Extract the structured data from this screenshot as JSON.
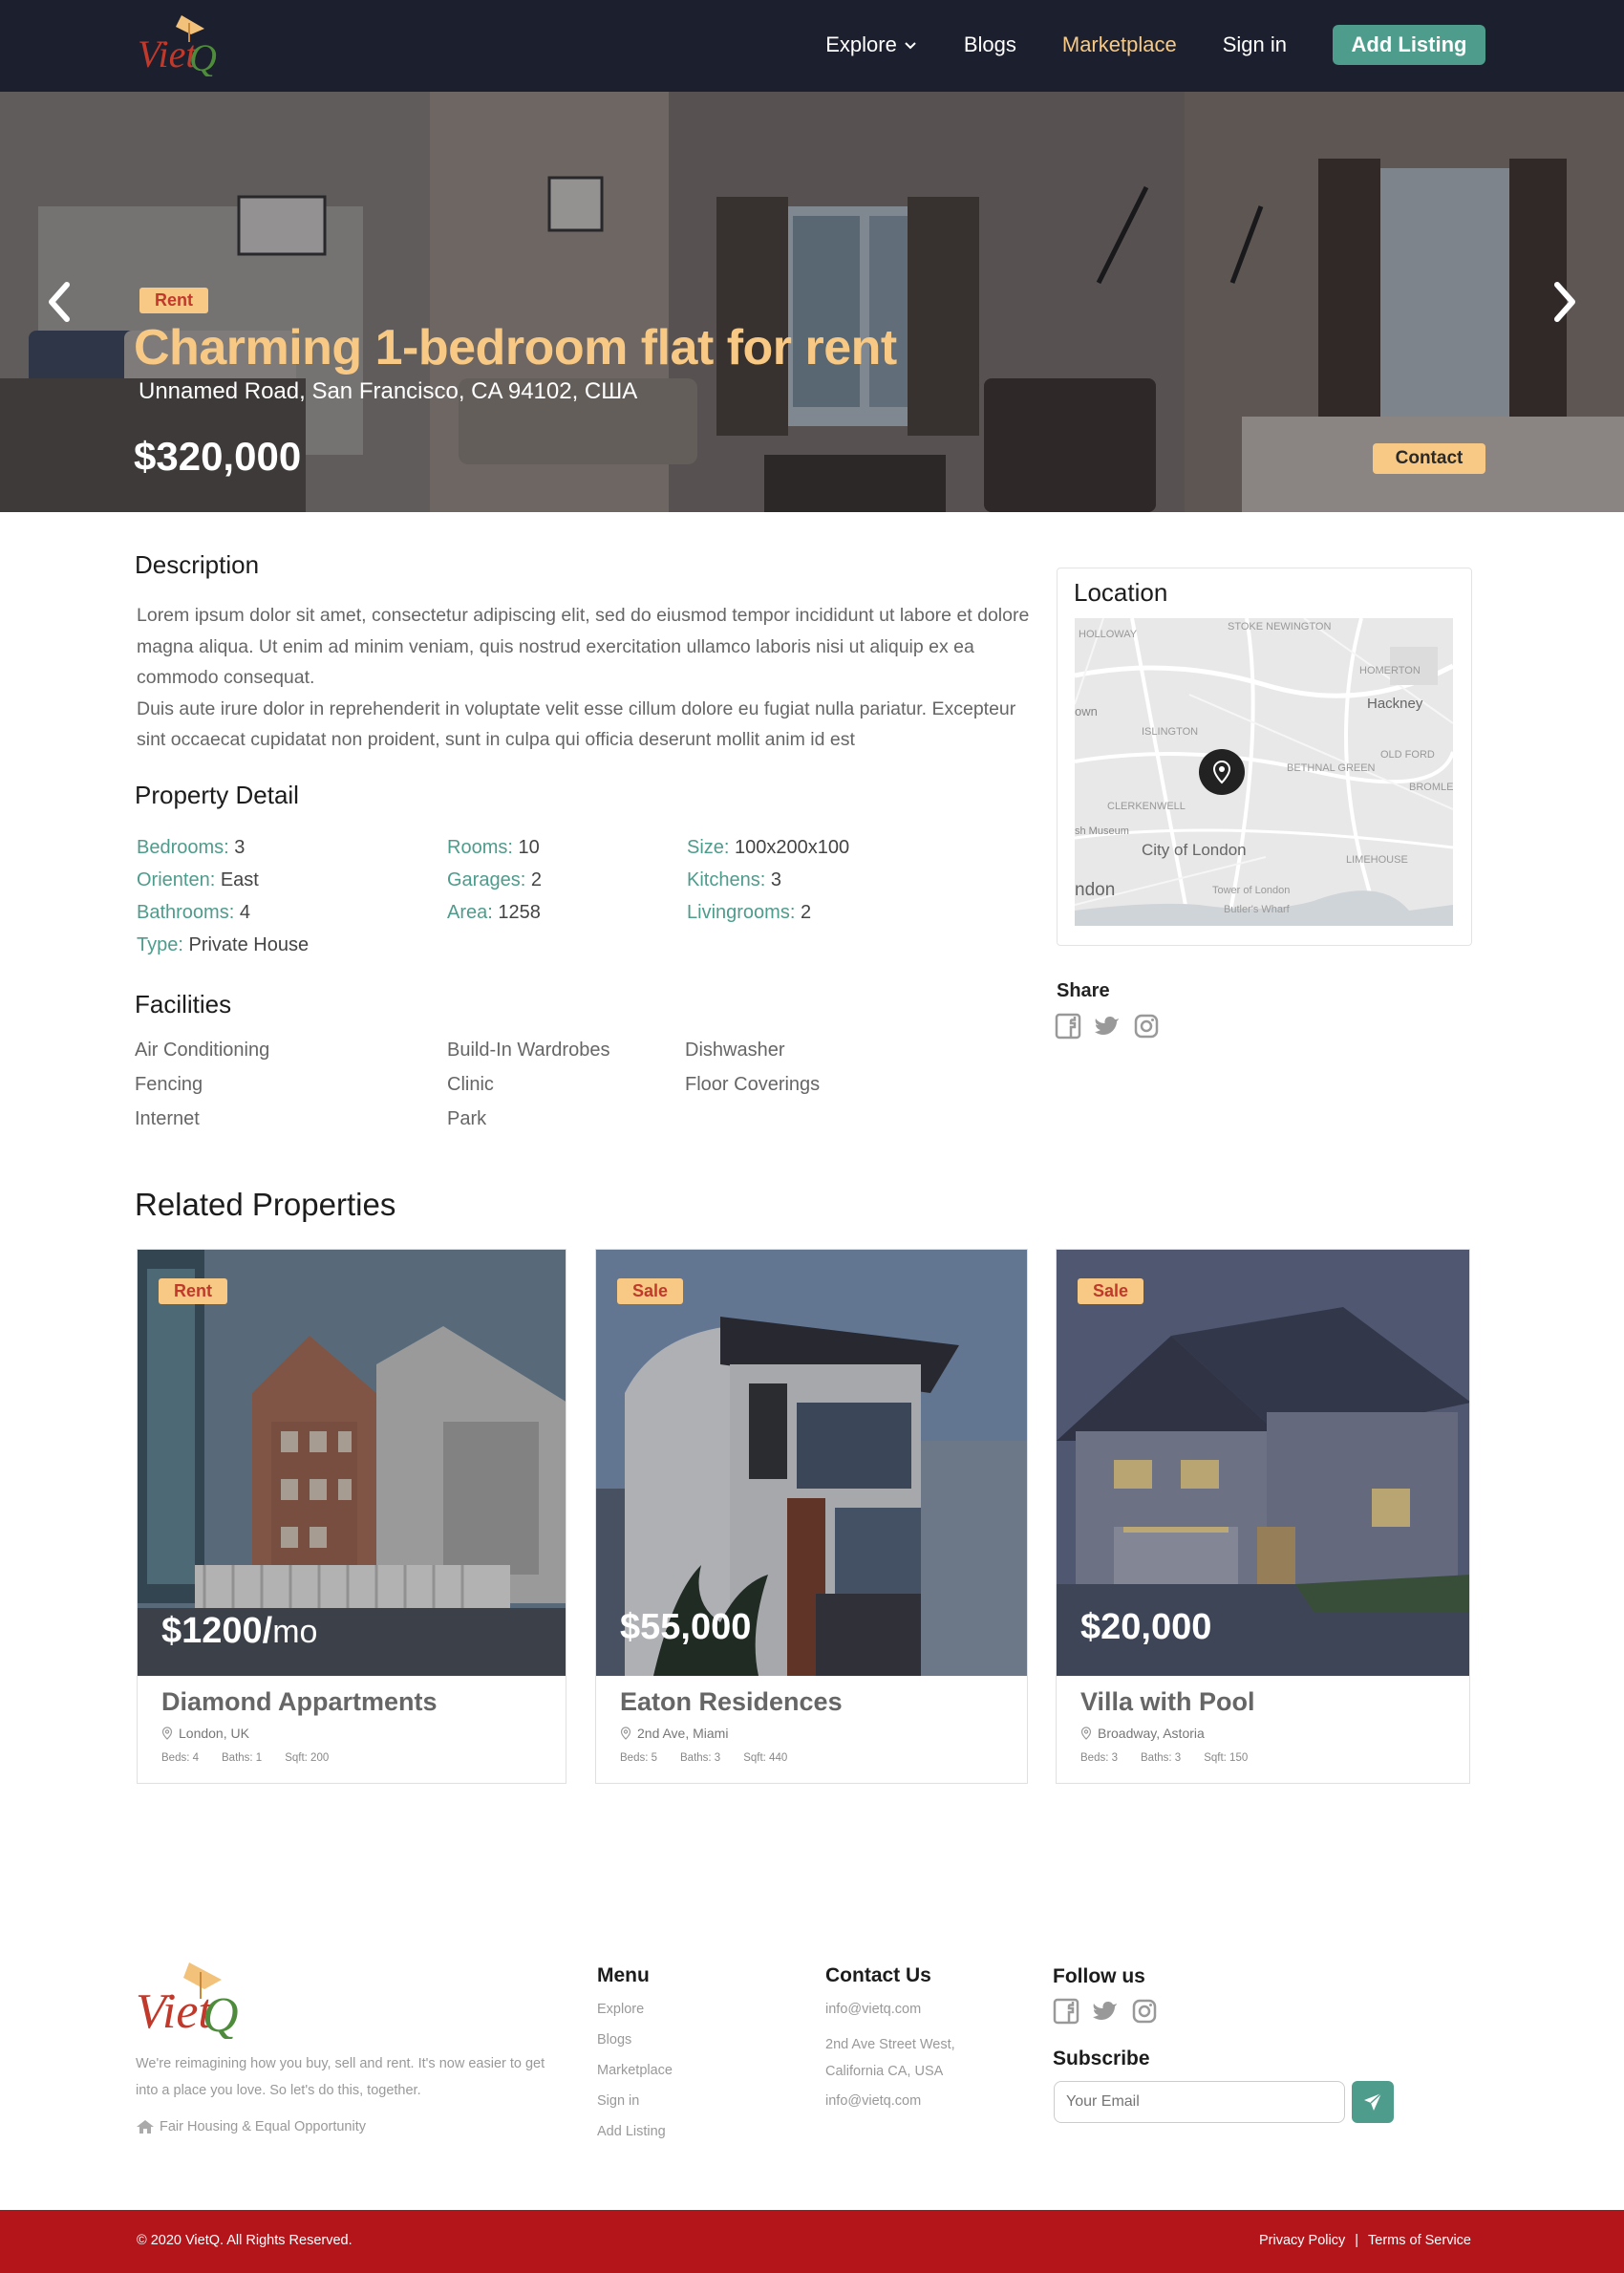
{
  "nav": {
    "logo_text": "VietQ",
    "links": [
      {
        "label": "Explore",
        "has_dropdown": true
      },
      {
        "label": "Blogs"
      },
      {
        "label": "Marketplace",
        "active": true
      },
      {
        "label": "Sign in"
      }
    ],
    "add_listing": "Add Listing"
  },
  "hero": {
    "badge": "Rent",
    "title": "Charming 1-bedroom flat for rent",
    "address": "Unnamed Road, San Francisco, CA 94102, США",
    "price": "$320,000",
    "contact": "Contact"
  },
  "description": {
    "heading": "Description",
    "text": "Lorem ipsum dolor sit amet, consectetur adipiscing elit, sed do eiusmod tempor incididunt ut labore et dolore magna aliqua. Ut enim ad minim veniam, quis nostrud exercitation ullamco laboris nisi ut aliquip ex ea commodo consequat.",
    "text2": "Duis aute irure dolor in reprehenderit in voluptate velit esse cillum dolore eu fugiat nulla pariatur. Excepteur sint occaecat cupidatat non proident, sunt in culpa qui officia deserunt mollit anim id est"
  },
  "property_detail": {
    "heading": "Property Detail",
    "items": [
      {
        "label": "Bedrooms:",
        "value": "3"
      },
      {
        "label": "Rooms:",
        "value": "10"
      },
      {
        "label": "Size:",
        "value": "100x200x100"
      },
      {
        "label": "Orienten:",
        "value": "East"
      },
      {
        "label": "Garages:",
        "value": "2"
      },
      {
        "label": "Kitchens:",
        "value": "3"
      },
      {
        "label": "Bathrooms:",
        "value": "4"
      },
      {
        "label": "Area:",
        "value": "1258"
      },
      {
        "label": "Livingrooms:",
        "value": "2"
      },
      {
        "label": "Type:",
        "value": "Private House"
      }
    ]
  },
  "facilities": {
    "heading": "Facilities",
    "items": [
      "Air Conditioning",
      "Build-In Wardrobes",
      "Dishwasher",
      "Fencing",
      "Clinic",
      "Floor Coverings",
      "Internet",
      "Park"
    ]
  },
  "location": {
    "heading": "Location",
    "map_labels": [
      "STOKE NEWINGTON",
      "HOLLOWAY",
      "HOMERTON",
      "Hackney",
      "own",
      "ISLINGTON",
      "OLD FORD",
      "BETHNAL GREEN",
      "BROMLEY-BY-BOW",
      "CLERKENWELL",
      "sh Museum",
      "City of London",
      "LIMEHOUSE",
      "ndon",
      "Tower of London",
      "Butler's Wharf"
    ]
  },
  "share": {
    "heading": "Share",
    "icons": [
      "facebook-icon",
      "twitter-icon",
      "instagram-icon"
    ]
  },
  "related": {
    "heading": "Related Properties",
    "cards": [
      {
        "badge": "Rent",
        "price": "$1200/",
        "unit": "mo",
        "name": "Diamond Appartments",
        "location": "London, UK",
        "beds": "Beds: 4",
        "baths": "Baths: 1",
        "sqft": "Sqft: 200"
      },
      {
        "badge": "Sale",
        "price": "$55,000",
        "unit": "",
        "name": "Eaton Residences",
        "location": "2nd Ave, Miami",
        "beds": "Beds: 5",
        "baths": "Baths: 3",
        "sqft": "Sqft: 440"
      },
      {
        "badge": "Sale",
        "price": "$20,000",
        "unit": "",
        "name": "Villa with Pool",
        "location": "Broadway, Astoria",
        "beds": "Beds: 3",
        "baths": "Baths: 3",
        "sqft": "Sqft: 150"
      }
    ]
  },
  "footer": {
    "about": "We're reimagining how you buy, sell and rent. It's now easier to get into a place you love. So let's do this, together.",
    "fair_housing": "Fair Housing & Equal Opportunity",
    "menu_heading": "Menu",
    "menu": [
      "Explore",
      "Blogs",
      "Marketplace",
      "Sign in",
      "Add Listing"
    ],
    "contact_heading": "Contact Us",
    "contact_email": "info@vietq.com",
    "contact_address": "2nd Ave Street West, California CA, USA",
    "contact_email2": "info@vietq.com",
    "follow_heading": "Follow us",
    "subscribe_heading": "Subscribe",
    "subscribe_placeholder": "Your Email",
    "copyright": "© 2020 VietQ. All Rights Reserved.",
    "privacy": "Privacy Policy",
    "separator": "|",
    "terms": "Terms of Service"
  },
  "colors": {
    "nav_bg": "#1c1f2e",
    "accent_green": "#4e9c8c",
    "accent_gold": "#f7c984",
    "badge_red": "#c0392b",
    "footer_bar": "#b3151b"
  }
}
